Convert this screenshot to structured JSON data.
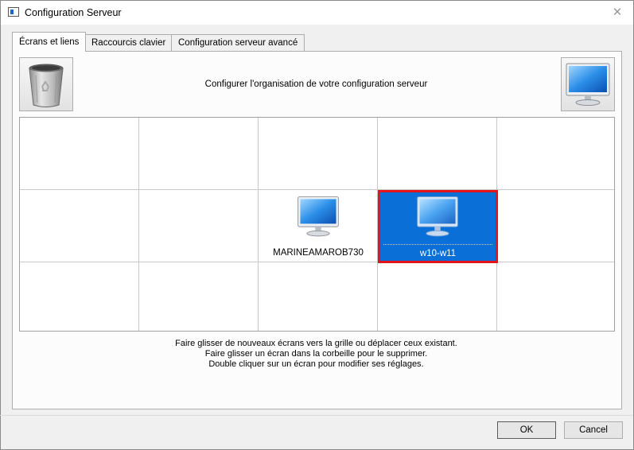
{
  "window": {
    "title": "Configuration Serveur",
    "close_glyph": "✕"
  },
  "tabs": [
    {
      "label": "Écrans et liens",
      "active": true
    },
    {
      "label": "Raccourcis clavier",
      "active": false
    },
    {
      "label": "Configuration serveur avancé",
      "active": false
    }
  ],
  "toolbar": {
    "trash_icon": "recycle-bin-icon",
    "new_screen_icon": "monitor-icon",
    "description": "Configurer l'organisation de votre configuration serveur"
  },
  "grid": {
    "rows": 3,
    "cols": 5,
    "screens": [
      {
        "name": "MARINEAMAROB730",
        "row": 1,
        "col": 2,
        "selected": false
      },
      {
        "name": "w10-w11",
        "row": 1,
        "col": 3,
        "selected": true
      }
    ]
  },
  "hints": [
    "Faire glisser de nouveaux écrans vers la grille ou déplacer ceux existant.",
    "Faire glisser un écran dans la corbeille pour le supprimer.",
    "Double cliquer sur un écran pour modifier ses réglages."
  ],
  "buttons": {
    "ok": "OK",
    "cancel": "Cancel"
  },
  "colors": {
    "selection": "#0b6fd8",
    "selection_border": "#e4141b"
  }
}
